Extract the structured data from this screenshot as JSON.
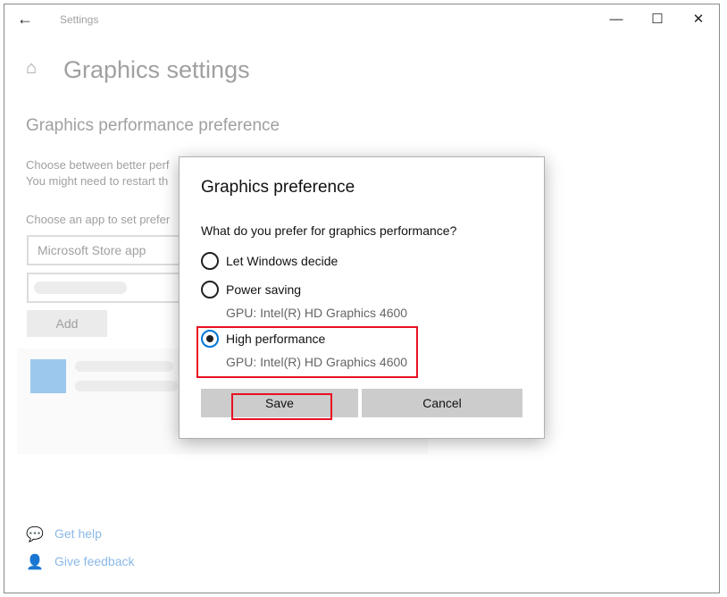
{
  "titlebar": {
    "title": "Settings",
    "back": "←",
    "minimize": "—",
    "maximize": "☐",
    "close": "✕"
  },
  "page": {
    "title": "Graphics settings",
    "section": "Graphics performance preference",
    "desc1": "Choose between better perf",
    "desc2": "You might need to restart th",
    "choose_label": "Choose an app to set prefer",
    "app_type": "Microsoft Store app",
    "add": "Add"
  },
  "footer": {
    "help": "Get help",
    "feedback": "Give feedback"
  },
  "dialog": {
    "title": "Graphics preference",
    "question": "What do you prefer for graphics performance?",
    "options": [
      {
        "label": "Let Windows decide",
        "selected": false
      },
      {
        "label": "Power saving",
        "gpu": "GPU: Intel(R) HD Graphics 4600",
        "selected": false
      },
      {
        "label": "High performance",
        "gpu": "GPU: Intel(R) HD Graphics 4600",
        "selected": true
      }
    ],
    "save": "Save",
    "cancel": "Cancel"
  },
  "colors": {
    "accent": "#0078d7",
    "highlight": "#e81123",
    "link": "#8ab8e6"
  }
}
